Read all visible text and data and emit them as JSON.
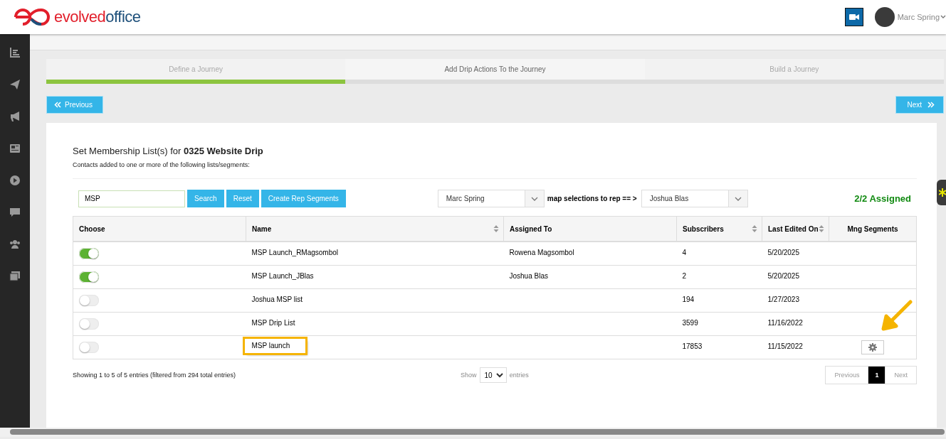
{
  "header": {
    "logo_red": "evolved",
    "logo_blue": "office",
    "user_name": "Marc Spring"
  },
  "sidebar": {
    "items": [
      {
        "kind": "chart"
      },
      {
        "kind": "send"
      },
      {
        "kind": "megaphone"
      },
      {
        "kind": "news"
      },
      {
        "kind": "play"
      },
      {
        "kind": "chat"
      },
      {
        "kind": "users"
      },
      {
        "kind": "images"
      }
    ]
  },
  "steps": [
    {
      "label": "Define a Journey",
      "completed": true,
      "selected": false
    },
    {
      "label": "Add Drip Actions To the Journey",
      "completed": false,
      "selected": true
    },
    {
      "label": "Build a Journey",
      "completed": false,
      "selected": false
    }
  ],
  "nav": {
    "previous": "Previous",
    "next": "Next"
  },
  "heading": {
    "prefix": "Set Membership List(s) for",
    "name": "0325 Website Drip",
    "subtitle": "Contacts added to one or more of the following lists/segments:"
  },
  "toolbar": {
    "search_value": "MSP",
    "search_button": "Search",
    "reset_button": "Reset",
    "create_button": "Create Rep Segments",
    "from_rep": "Marc Spring",
    "map_label": "map selections to rep == >",
    "to_rep": "Joshua Blas",
    "assigned": "2/2 Assigned"
  },
  "table": {
    "columns": [
      {
        "label": "Choose",
        "sortable": false
      },
      {
        "label": "Name",
        "sortable": true
      },
      {
        "label": "Assigned To",
        "sortable": false
      },
      {
        "label": "Subscribers",
        "sortable": true
      },
      {
        "label": "Last Edited On",
        "sortable": true
      },
      {
        "label": "Mng Segments",
        "sortable": false
      }
    ],
    "rows": [
      {
        "checked": true,
        "name": "MSP Launch_RMagsombol",
        "assigned_to": "Rowena Magsombol",
        "subscribers": "4",
        "last_edited": "5/20/2025",
        "manage_button": false,
        "highlighted": false
      },
      {
        "checked": true,
        "name": "MSP Launch_JBlas",
        "assigned_to": "Joshua Blas",
        "subscribers": "2",
        "last_edited": "5/20/2025",
        "manage_button": false,
        "highlighted": false
      },
      {
        "checked": false,
        "name": "Joshua MSP list",
        "assigned_to": "",
        "subscribers": "194",
        "last_edited": "1/27/2023",
        "manage_button": false,
        "highlighted": false
      },
      {
        "checked": false,
        "name": "MSP Drip List",
        "assigned_to": "",
        "subscribers": "3599",
        "last_edited": "11/16/2022",
        "manage_button": false,
        "highlighted": false
      },
      {
        "checked": false,
        "name": "MSP launch",
        "assigned_to": "",
        "subscribers": "17853",
        "last_edited": "11/15/2022",
        "manage_button": true,
        "highlighted": true
      }
    ]
  },
  "footer": {
    "info": "Showing 1 to 5 of 5 entries (filtered from 294 total entries)",
    "show": "Show",
    "page_size": "10",
    "entries": "entries",
    "pager": [
      {
        "label": "Previous",
        "selected": false
      },
      {
        "label": "1",
        "selected": true
      },
      {
        "label": "Next",
        "selected": false
      }
    ]
  }
}
